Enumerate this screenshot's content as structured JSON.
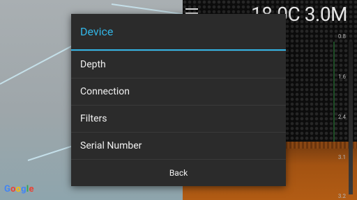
{
  "status": {
    "temperature_depth": "18.0C 3.0M"
  },
  "sonar": {
    "scale_labels": [
      "0.8",
      "1.6",
      "2.4",
      "3.1",
      "3.2"
    ]
  },
  "map": {
    "logo_letters": [
      "G",
      "o",
      "o",
      "g",
      "l",
      "e"
    ]
  },
  "dialog": {
    "title": "Device",
    "items": [
      {
        "label": "Depth"
      },
      {
        "label": "Connection"
      },
      {
        "label": "Filters"
      },
      {
        "label": "Serial Number"
      }
    ],
    "back_label": "Back"
  },
  "colors": {
    "accent": "#33b5e5",
    "dialog_bg": "#2b2b2b",
    "sonar_bottom": "#a35312"
  },
  "icons": [
    "menu-icon",
    "google-logo"
  ]
}
